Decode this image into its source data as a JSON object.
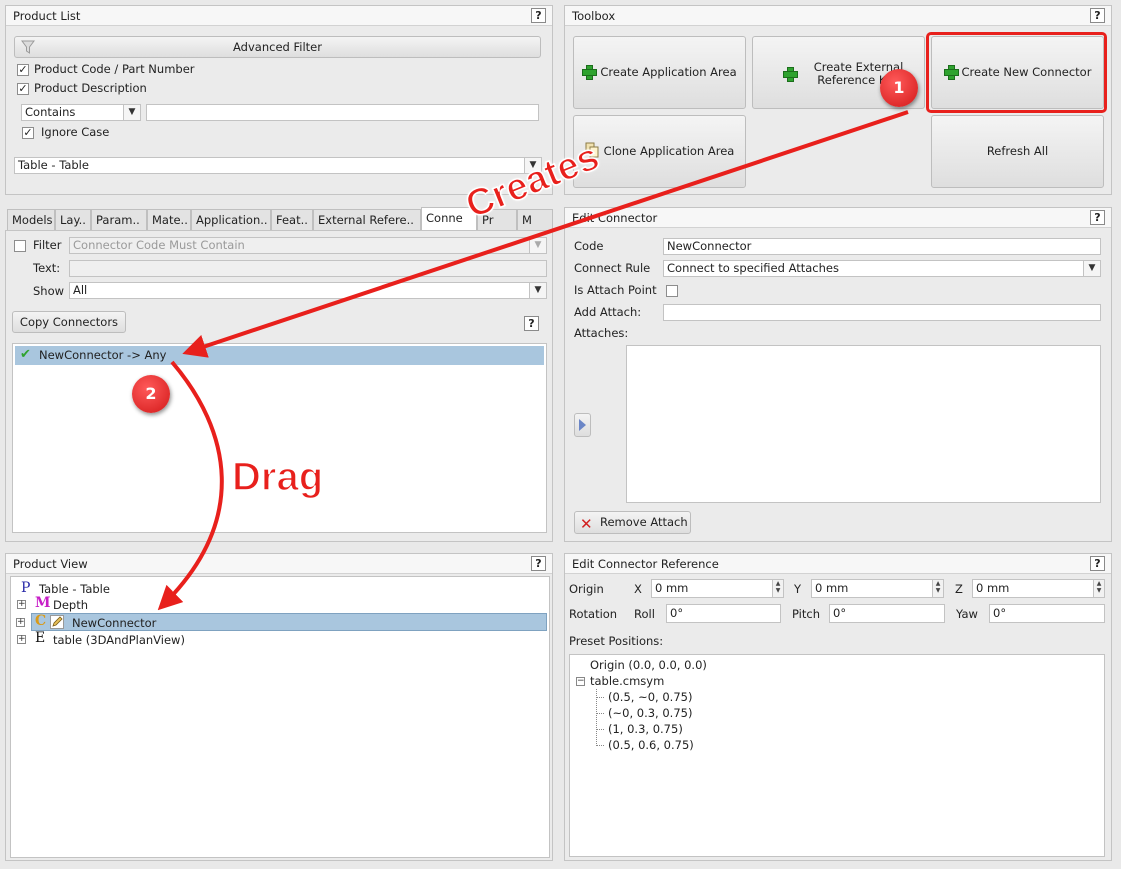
{
  "product_list": {
    "title": "Product List",
    "help": "?",
    "advanced_filter": "Advanced Filter",
    "opt_code": "Product Code / Part Number",
    "opt_description": "Product Description",
    "match_mode": "Contains",
    "search_value": "",
    "ignore_case": "Ignore Case",
    "table_select": "Table - Table"
  },
  "tabs": {
    "items": [
      "Models",
      "Lay..",
      "Param..",
      "Mate..",
      "Application..",
      "Feat..",
      "External Refere..",
      "Conne",
      "Pr",
      "M"
    ],
    "active": "Conne"
  },
  "connectors_tab": {
    "filter_label": "Filter",
    "filter_placeholder": "Connector Code Must Contain",
    "text_label": "Text:",
    "show_label": "Show",
    "show_value": "All",
    "copy_button": "Copy Connectors",
    "help": "?",
    "items": [
      {
        "label": "NewConnector -> Any"
      }
    ]
  },
  "toolbox": {
    "title": "Toolbox",
    "help": "?",
    "create_application_area": "Create Application Area",
    "create_external_ref_line1": "Create External",
    "create_external_ref_line2": "Reference Key",
    "create_new_connector": "Create New Connector",
    "clone_application_area": "Clone Application Area",
    "refresh_all": "Refresh All"
  },
  "edit_connector": {
    "title": "Edit Connector",
    "help": "?",
    "code_label": "Code",
    "code_value": "NewConnector",
    "rule_label": "Connect Rule",
    "rule_value": "Connect to specified Attaches",
    "attach_point_label": "Is Attach Point",
    "add_attach_label": "Add Attach:",
    "add_attach_value": "",
    "attaches_label": "Attaches:",
    "remove_attach": "Remove Attach"
  },
  "product_view": {
    "title": "Product View",
    "help": "?",
    "tree": [
      {
        "glyph": "P",
        "label": "Table - Table"
      },
      {
        "glyph": "M",
        "label": "Depth"
      },
      {
        "glyph": "C",
        "label": "NewConnector"
      },
      {
        "glyph": "E",
        "label": "table (3DAndPlanView)"
      }
    ]
  },
  "edit_connector_reference": {
    "title": "Edit Connector Reference",
    "help": "?",
    "origin_label": "Origin",
    "x_label": "X",
    "x_value": "0 mm",
    "y_label": "Y",
    "y_value": "0 mm",
    "z_label": "Z",
    "z_value": "0 mm",
    "rotation_label": "Rotation",
    "roll_label": "Roll",
    "roll_value": "0°",
    "pitch_label": "Pitch",
    "pitch_value": "0°",
    "yaw_label": "Yaw",
    "yaw_value": "0°",
    "preset_label": "Preset Positions:",
    "preset_root": "Origin (0.0, 0.0, 0.0)",
    "preset_group": "table.cmsym",
    "preset_children": [
      "(0.5, ~0, 0.75)",
      "(~0, 0.3, 0.75)",
      "(1, 0.3, 0.75)",
      "(0.5, 0.6, 0.75)"
    ]
  },
  "annotations": {
    "step1": "1",
    "step2": "2",
    "creates": "Creates",
    "drag": "Drag",
    "color": "#e8201c"
  },
  "colors": {
    "selection": "#a9c6de",
    "check_green": "#2fa32f",
    "remove_red": "#d22020"
  }
}
